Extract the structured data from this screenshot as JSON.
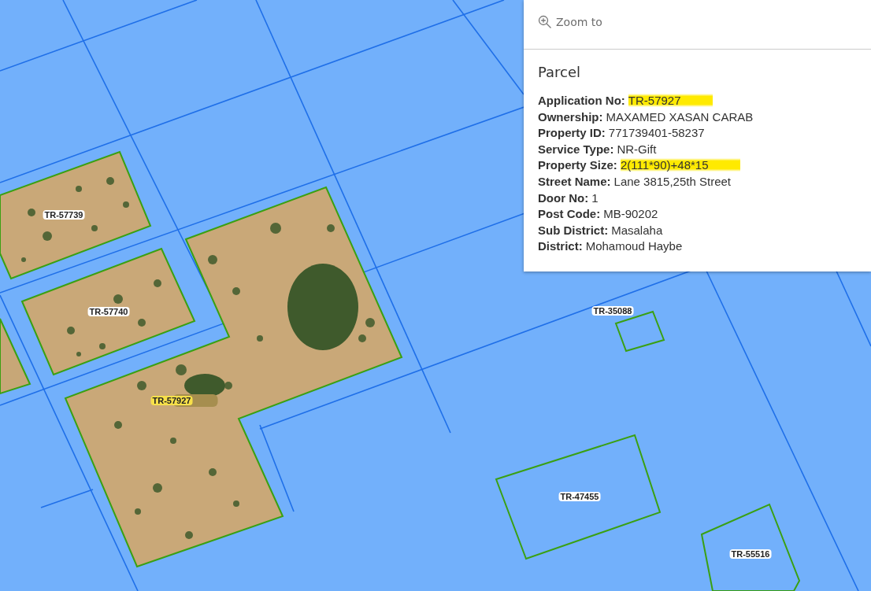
{
  "map": {
    "parcels": [
      {
        "label": "TR-57739",
        "kind": "imagery",
        "highlighted": false
      },
      {
        "label": "TR-57740",
        "kind": "imagery",
        "highlighted": false
      },
      {
        "label": "TR-57927",
        "kind": "imagery",
        "highlighted": true
      },
      {
        "label": "TR-35088",
        "kind": "outline",
        "highlighted": false
      },
      {
        "label": "TR-47455",
        "kind": "outline",
        "highlighted": false
      },
      {
        "label": "TR-55516",
        "kind": "outline",
        "highlighted": false
      }
    ]
  },
  "popup": {
    "action": "Zoom to",
    "title": "Parcel",
    "fields": [
      {
        "label": "Application No:",
        "value": "TR-57927",
        "highlighted": true
      },
      {
        "label": "Ownership:",
        "value": "MAXAMED XASAN CARAB",
        "highlighted": false
      },
      {
        "label": "Property ID:",
        "value": "771739401-58237",
        "highlighted": false
      },
      {
        "label": "Service Type:",
        "value": "NR-Gift",
        "highlighted": false
      },
      {
        "label": "Property Size:",
        "value": "2(111*90)+48*15",
        "highlighted": true
      },
      {
        "label": "Street Name:",
        "value": "Lane 3815,25th Street",
        "highlighted": false
      },
      {
        "label": "Door No:",
        "value": "1",
        "highlighted": false
      },
      {
        "label": "Post Code:",
        "value": "MB-90202",
        "highlighted": false
      },
      {
        "label": "Sub District:",
        "value": "Masalaha",
        "highlighted": false
      },
      {
        "label": "District:",
        "value": "Mohamoud Haybe",
        "highlighted": false
      }
    ]
  }
}
